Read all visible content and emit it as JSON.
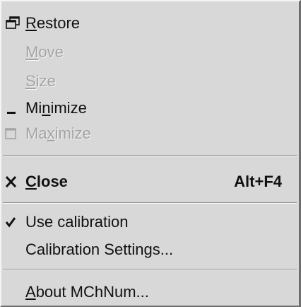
{
  "menu": {
    "restore": {
      "pre": "",
      "key": "R",
      "post": "estore",
      "disabled": false
    },
    "move": {
      "pre": "",
      "key": "M",
      "post": "ove",
      "disabled": true
    },
    "size": {
      "pre": "",
      "key": "S",
      "post": "ize",
      "disabled": true
    },
    "minimize": {
      "pre": "Mi",
      "key": "n",
      "post": "imize",
      "disabled": false
    },
    "maximize": {
      "pre": "Ma",
      "key": "x",
      "post": "imize",
      "disabled": true
    },
    "close": {
      "pre": "",
      "key": "C",
      "post": "lose",
      "accelerator": "Alt+F4",
      "bold": true
    },
    "use_calibration": {
      "label": "Use calibration",
      "checked": true
    },
    "calibration_settings": {
      "label": "Calibration Settings..."
    },
    "about": {
      "pre": "",
      "key": "A",
      "post": "bout MChNum..."
    }
  },
  "icons": {
    "restore": "restore-window-icon",
    "minimize": "minimize-icon",
    "maximize": "maximize-icon",
    "close": "close-x-icon",
    "check": "checkmark-icon"
  },
  "colors": {
    "menu_background": "#d8d8d8",
    "text": "#111111",
    "disabled_text": "#a3a3a3",
    "disabled_highlight": "#f6f6f6"
  }
}
